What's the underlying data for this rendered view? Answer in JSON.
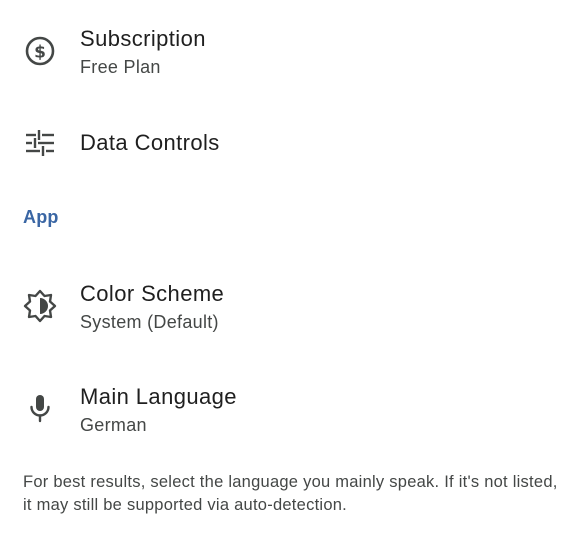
{
  "account_section": {
    "subscription": {
      "icon": "dollar-circle-icon",
      "title": "Subscription",
      "subtitle": "Free Plan"
    },
    "data_controls": {
      "icon": "sliders-icon",
      "title": "Data Controls"
    }
  },
  "app_section": {
    "header": "App",
    "color_scheme": {
      "icon": "brightness-icon",
      "title": "Color Scheme",
      "subtitle": "System (Default)"
    },
    "main_language": {
      "icon": "microphone-icon",
      "title": "Main Language",
      "subtitle": "German"
    },
    "footer_note": "For best results, select the language you mainly speak. If it's not listed, it may still be supported via auto-detection."
  },
  "colors": {
    "section_header": "#3a66a4",
    "title_text": "#1f1f1f",
    "subtitle_text": "#444746",
    "icon": "#444746",
    "background": "#ffffff"
  }
}
